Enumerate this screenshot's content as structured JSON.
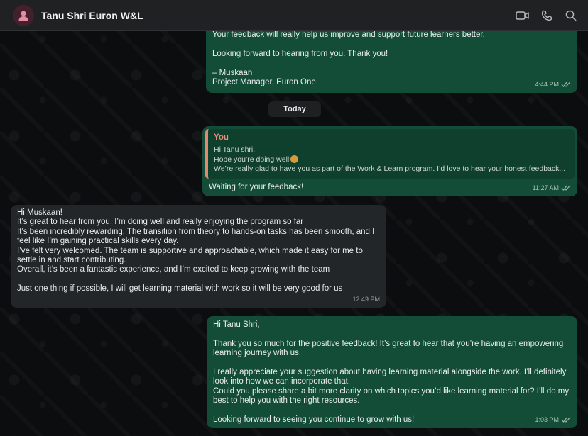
{
  "chat": {
    "title": "Tanu Shri Euron W&L",
    "header_icons": [
      "video-call-icon",
      "phone-icon",
      "search-icon"
    ]
  },
  "messages": {
    "m1": {
      "lines": [
        "Your feedback will really help us improve and support future learners better.",
        "",
        "Looking forward to hearing from you. Thank you!",
        "",
        "– Muskaan",
        "Project Manager, Euron One"
      ],
      "time": "4:44 PM"
    },
    "date_divider": "Today",
    "m2": {
      "quote_author": "You",
      "quote_lines": [
        "Hi Tanu shri,",
        "Hope you’re doing well",
        "We’re really glad to have you as part of the Work & Learn program. I’d love to hear your honest feedback..."
      ],
      "text": "Waiting for your feedback!",
      "time": "11:27 AM"
    },
    "m3": {
      "lines": [
        "Hi Muskaan!",
        "It’s great to hear from you. I’m doing well and really enjoying the program so far",
        "It’s been incredibly rewarding. The transition from theory to hands-on tasks has been smooth, and I",
        "feel like I’m gaining practical skills every day.",
        "I’ve felt very welcomed. The team is supportive and approachable, which made it easy for me to",
        "settle in and start contributing.",
        "Overall, it’s been a fantastic experience, and I’m excited to keep growing with the team",
        "",
        "Just one thing if possible, I will get learning material with work so it will be very good for us"
      ],
      "time": "12:49 PM"
    },
    "m4": {
      "lines": [
        "Hi Tanu Shri,",
        "",
        "Thank you so much for the positive feedback! It’s great to hear that you’re having an empowering",
        "learning journey with us.",
        "",
        "I really appreciate your suggestion about having learning material alongside the work. I’ll definitely",
        "look into how we can incorporate that.",
        "Could you please share a bit more clarity on which topics you’d like learning material for? I’ll do my",
        "best to help you with the right resources.",
        "",
        "Looking forward to seeing you continue to grow with us!"
      ],
      "time": "1:03 PM"
    }
  },
  "colors": {
    "outgoing_bubble": "#144d37",
    "incoming_bubble": "#232628",
    "quote_accent": "#e08a74"
  }
}
